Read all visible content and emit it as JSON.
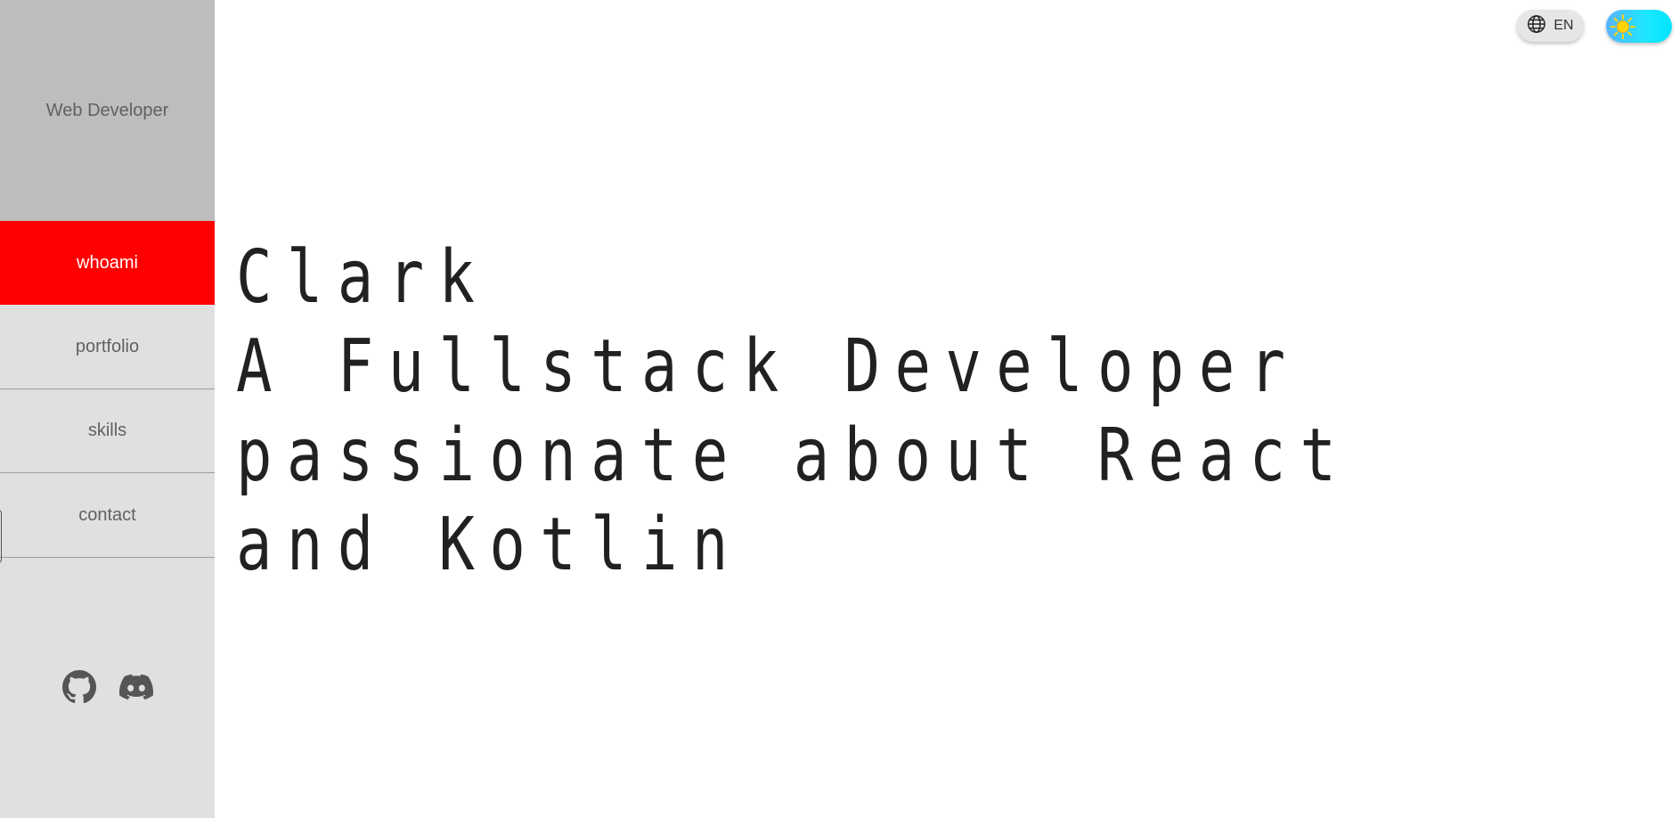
{
  "sidebar": {
    "subtitle": "Web Developer",
    "nav": [
      {
        "label": "whoami",
        "active": true
      },
      {
        "label": "portfolio",
        "active": false
      },
      {
        "label": "skills",
        "active": false
      },
      {
        "label": "contact",
        "active": false
      }
    ],
    "social": [
      {
        "icon": "github-icon"
      },
      {
        "icon": "discord-icon"
      }
    ]
  },
  "header": {
    "language": {
      "icon": "globe-icon",
      "label": "EN"
    },
    "theme_toggle": {
      "icon": "sun-icon",
      "state": "light"
    }
  },
  "hero": {
    "name": "Clark",
    "tagline": "A Fullstack Developer passionate about React and Kotlin"
  },
  "colors": {
    "accent": "#ff0000",
    "sidebar_bg": "#e0e0e0",
    "sidebar_header_bg": "#bdbdbd",
    "toggle_gradient": "#00e5ff",
    "text": "#212121"
  }
}
